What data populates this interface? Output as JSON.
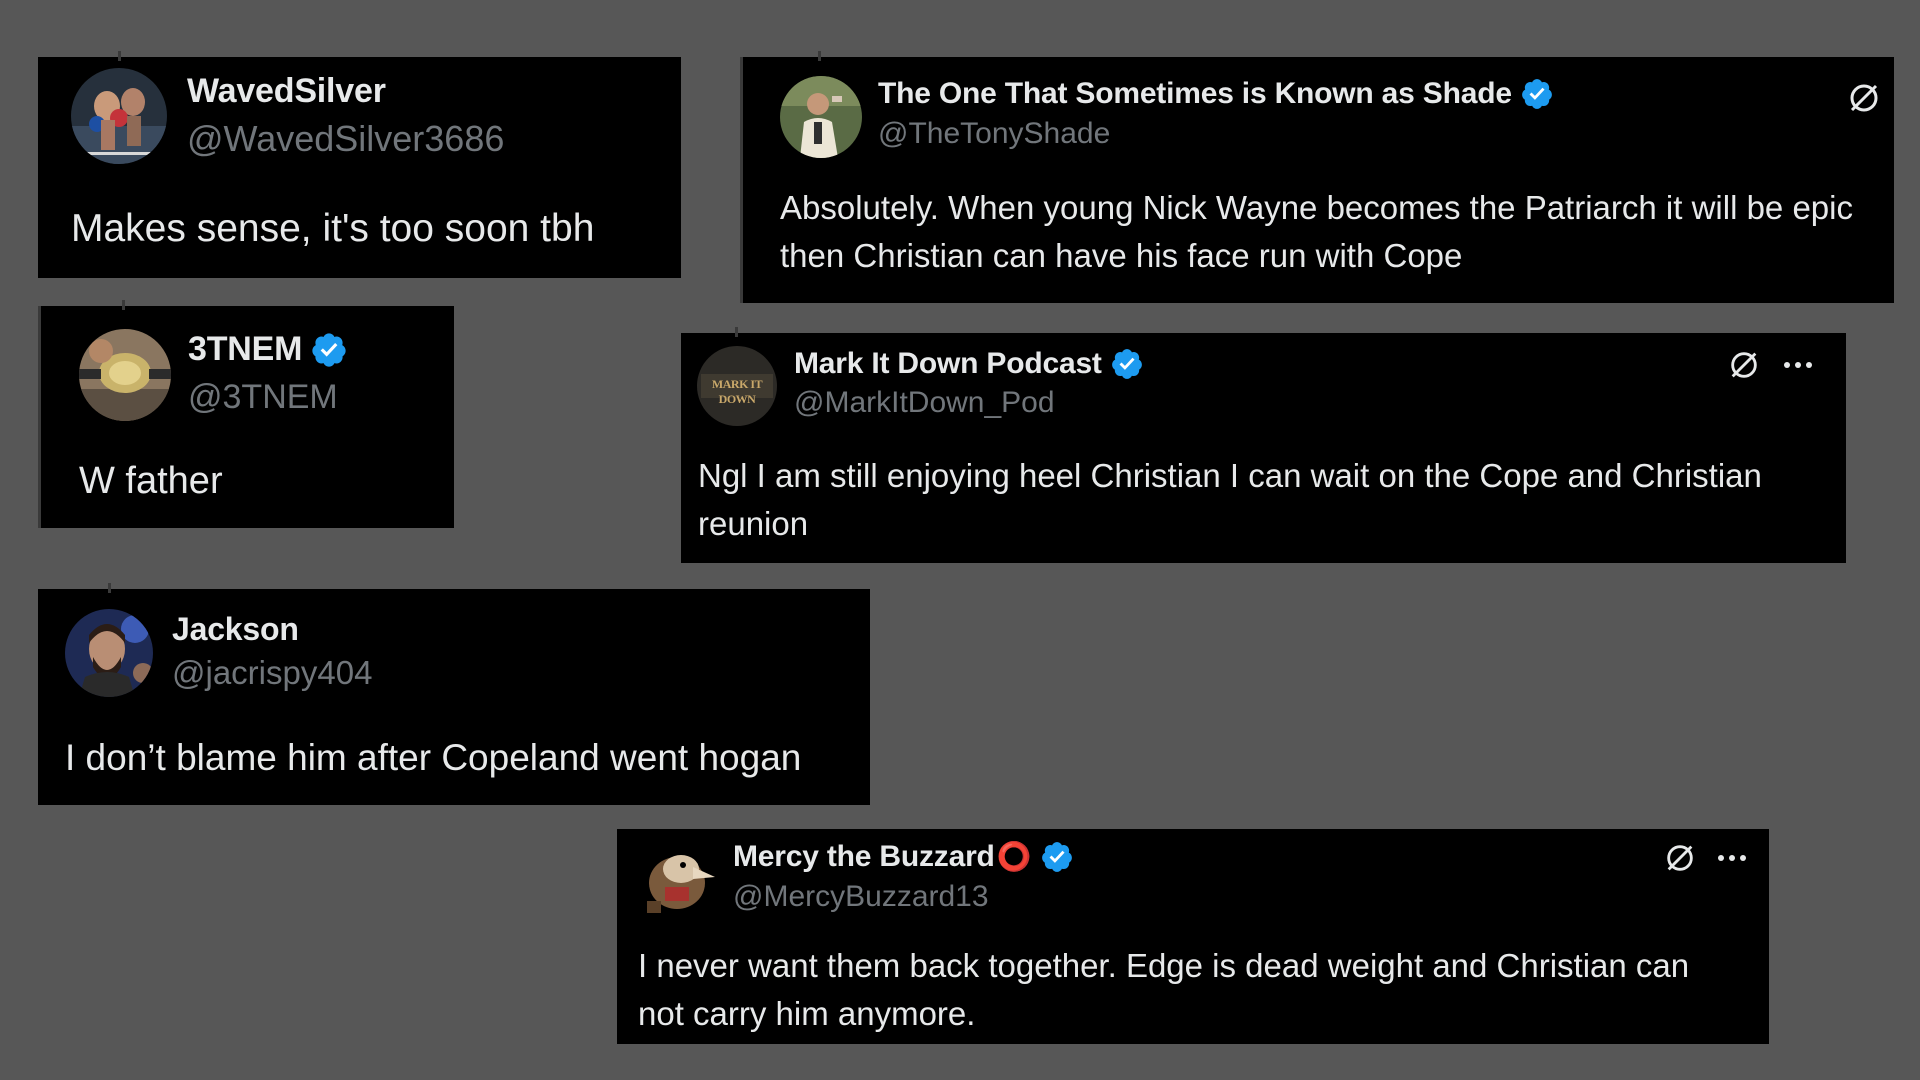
{
  "tweets": [
    {
      "id": "wavedsilver",
      "name": "WavedSilver",
      "handle": "@WavedSilver3686",
      "text": "Makes sense, it's too soon tbh",
      "verified": false,
      "avatar": "boxing-match-avatar"
    },
    {
      "id": "tonyshade",
      "name": "The One That Sometimes is Known as Shade",
      "handle": "@TheTonyShade",
      "text": "Absolutely. When young Nick Wayne becomes the Patriarch it will be epic then Christian can have his face run with Cope",
      "verified": true,
      "avatar": "person-white-suit-avatar",
      "icons": [
        "grok-icon"
      ]
    },
    {
      "id": "3tnem",
      "name": "3TNEM",
      "handle": "@3TNEM",
      "text": "W father",
      "verified": true,
      "avatar": "championship-belt-avatar"
    },
    {
      "id": "markitdown",
      "name": "Mark It Down Podcast",
      "handle": "@MarkItDown_Pod",
      "text": "Ngl I am still enjoying heel Christian I can wait on the Cope and Christian reunion",
      "verified": true,
      "avatar": "podcast-logo-avatar",
      "avatar_text": "MARK IT DOWN",
      "icons": [
        "grok-icon",
        "more-icon"
      ]
    },
    {
      "id": "jackson",
      "name": "Jackson",
      "handle": "@jacrispy404",
      "text": "I don’t blame him after Copeland went hogan",
      "verified": false,
      "avatar": "bearded-man-avatar"
    },
    {
      "id": "mercy",
      "name": "Mercy the Buzzard",
      "name_badge": "⭕",
      "handle": "@MercyBuzzard13",
      "text": "I never want them back together. Edge is dead weight and Christian can not carry him anymore.",
      "verified": true,
      "avatar": "buzzard-avatar",
      "icons": [
        "grok-icon",
        "more-icon"
      ]
    }
  ],
  "colors": {
    "background": "#575757",
    "card": "#000000",
    "text": "#e7e9ea",
    "handle": "#71767b",
    "verified": "#1d9bf0",
    "badge": "#e0245e"
  }
}
